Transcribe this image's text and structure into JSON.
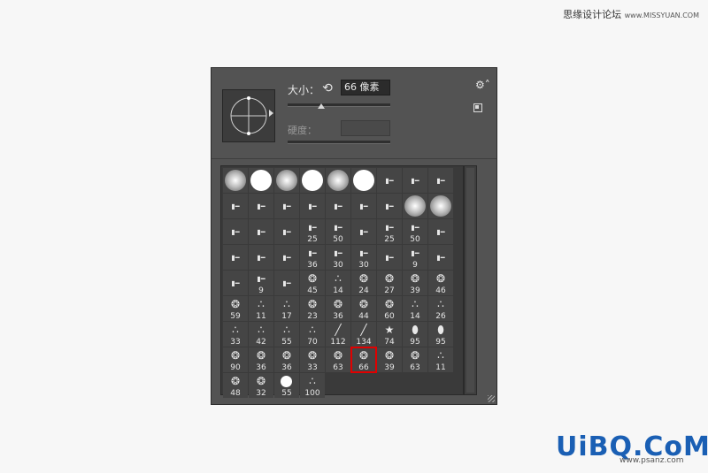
{
  "watermark_top": {
    "text": "思缘设计论坛",
    "url": "www.MISSYUAN.COM"
  },
  "logo": {
    "text": "UiBQ.CoM",
    "url": "www.psanz.com"
  },
  "brush_panel": {
    "size_label": "大小：",
    "size_value": "66 像素",
    "size_slider_fraction": 0.33,
    "hardness_label": "硬度：",
    "hardness_value": ""
  },
  "brushes": [
    {
      "kind": "soft",
      "num": ""
    },
    {
      "kind": "hard",
      "num": ""
    },
    {
      "kind": "soft",
      "num": ""
    },
    {
      "kind": "hard",
      "num": ""
    },
    {
      "kind": "soft",
      "num": ""
    },
    {
      "kind": "hard",
      "num": ""
    },
    {
      "kind": "tip",
      "num": ""
    },
    {
      "kind": "tip",
      "num": ""
    },
    {
      "kind": "tip",
      "num": ""
    },
    {
      "kind": "tip",
      "num": ""
    },
    {
      "kind": "tip",
      "num": ""
    },
    {
      "kind": "tip",
      "num": ""
    },
    {
      "kind": "tip",
      "num": ""
    },
    {
      "kind": "tip",
      "num": ""
    },
    {
      "kind": "tip",
      "num": ""
    },
    {
      "kind": "tip",
      "num": ""
    },
    {
      "kind": "soft",
      "num": ""
    },
    {
      "kind": "soft",
      "num": ""
    },
    {
      "kind": "tip",
      "num": ""
    },
    {
      "kind": "tip",
      "num": ""
    },
    {
      "kind": "tip",
      "num": ""
    },
    {
      "kind": "tip",
      "num": "25"
    },
    {
      "kind": "tip",
      "num": "50"
    },
    {
      "kind": "tip",
      "num": ""
    },
    {
      "kind": "tip",
      "num": "25"
    },
    {
      "kind": "tip",
      "num": "50"
    },
    {
      "kind": "tip",
      "num": ""
    },
    {
      "kind": "tip",
      "num": ""
    },
    {
      "kind": "tip",
      "num": ""
    },
    {
      "kind": "tip",
      "num": ""
    },
    {
      "kind": "tip",
      "num": "36"
    },
    {
      "kind": "tip",
      "num": "30"
    },
    {
      "kind": "tip",
      "num": "30"
    },
    {
      "kind": "tip",
      "num": ""
    },
    {
      "kind": "tip",
      "num": "9"
    },
    {
      "kind": "tip",
      "num": ""
    },
    {
      "kind": "tip",
      "num": ""
    },
    {
      "kind": "tip",
      "num": "9"
    },
    {
      "kind": "tip",
      "num": ""
    },
    {
      "kind": "splat",
      "num": "45"
    },
    {
      "kind": "dots",
      "num": "14"
    },
    {
      "kind": "splat",
      "num": "24"
    },
    {
      "kind": "splat",
      "num": "27"
    },
    {
      "kind": "splat",
      "num": "39"
    },
    {
      "kind": "splat",
      "num": "46"
    },
    {
      "kind": "splat",
      "num": "59"
    },
    {
      "kind": "dots",
      "num": "11"
    },
    {
      "kind": "dots",
      "num": "17"
    },
    {
      "kind": "splat",
      "num": "23"
    },
    {
      "kind": "splat",
      "num": "36"
    },
    {
      "kind": "splat",
      "num": "44"
    },
    {
      "kind": "splat",
      "num": "60"
    },
    {
      "kind": "dots",
      "num": "14"
    },
    {
      "kind": "dots",
      "num": "26"
    },
    {
      "kind": "dots",
      "num": "33"
    },
    {
      "kind": "dots",
      "num": "42"
    },
    {
      "kind": "dots",
      "num": "55"
    },
    {
      "kind": "dots",
      "num": "70"
    },
    {
      "kind": "grass",
      "num": "112"
    },
    {
      "kind": "grass",
      "num": "134"
    },
    {
      "kind": "star",
      "num": "74"
    },
    {
      "kind": "leaf",
      "num": "95"
    },
    {
      "kind": "leaf",
      "num": "95"
    },
    {
      "kind": "splat",
      "num": "90"
    },
    {
      "kind": "splat",
      "num": "36"
    },
    {
      "kind": "splat",
      "num": "36"
    },
    {
      "kind": "splat",
      "num": "33"
    },
    {
      "kind": "splat",
      "num": "63"
    },
    {
      "kind": "splat",
      "num": "66",
      "selected": true
    },
    {
      "kind": "splat",
      "num": "39"
    },
    {
      "kind": "splat",
      "num": "63"
    },
    {
      "kind": "dots",
      "num": "11"
    },
    {
      "kind": "splat",
      "num": "48"
    },
    {
      "kind": "splat",
      "num": "32"
    },
    {
      "kind": "hard",
      "num": "55"
    },
    {
      "kind": "dots",
      "num": "100"
    }
  ]
}
